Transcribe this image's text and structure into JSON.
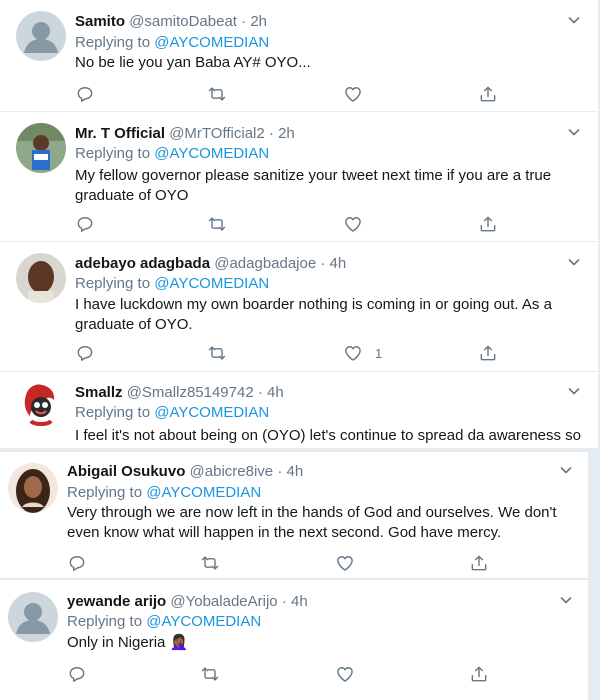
{
  "tweets": [
    {
      "name": "Samito",
      "handle": "@samitoDabeat",
      "dot": "·",
      "time": "2h",
      "replying_label": "Replying to",
      "replying_mention": "@AYCOMEDIAN",
      "text": "No be lie you yan Baba AY# OYO...",
      "avatar_icon": "default-avatar",
      "like_count": ""
    },
    {
      "name": "Mr. T Official",
      "handle": "@MrTOfficial2",
      "dot": "·",
      "time": "2h",
      "replying_label": "Replying to",
      "replying_mention": "@AYCOMEDIAN",
      "text": "My fellow governor please sanitize your tweet next time if you are a true graduate of OYO",
      "avatar_icon": "photo-avatar",
      "like_count": ""
    },
    {
      "name": "adebayo adagbada",
      "handle": "@adagbadajoe",
      "dot": "·",
      "time": "4h",
      "replying_label": "Replying to",
      "replying_mention": "@AYCOMEDIAN",
      "text": "I have luckdown my own boarder nothing is coming in or going out. As a graduate of OYO.",
      "avatar_icon": "photo-avatar",
      "like_count": "1"
    },
    {
      "name": "Smallz",
      "handle": "@Smallz85149742",
      "dot": "·",
      "time": "4h",
      "replying_label": "Replying to",
      "replying_mention": "@AYCOMEDIAN",
      "text": "I feel it's not about being on (OYO) let's continue to spread da awareness so",
      "avatar_icon": "cartoon-avatar",
      "like_count": ""
    },
    {
      "name": "Abigail Osukuvo",
      "handle": "@abicre8ive",
      "dot": "·",
      "time": "4h",
      "replying_label": "Replying to",
      "replying_mention": "@AYCOMEDIAN",
      "text": "Very through we are now left in the hands  of God and ourselves. We don't even know what will happen in the next second. God have mercy.",
      "avatar_icon": "photo-avatar",
      "like_count": ""
    },
    {
      "name": "yewande arijo",
      "handle": "@YobaladeArijo",
      "dot": "·",
      "time": "4h",
      "replying_label": "Replying to",
      "replying_mention": "@AYCOMEDIAN",
      "text": "Only in Nigeria 🤦🏾‍♀️",
      "avatar_icon": "default-avatar",
      "like_count": ""
    }
  ],
  "icons": {
    "reply": "reply-icon",
    "retweet": "retweet-icon",
    "like": "heart-icon",
    "share": "share-icon",
    "menu": "chevron-down-icon"
  },
  "colors": {
    "link": "#1b95e0",
    "secondary": "#657786",
    "icon": "#657786",
    "background": "#e6ecf0"
  }
}
